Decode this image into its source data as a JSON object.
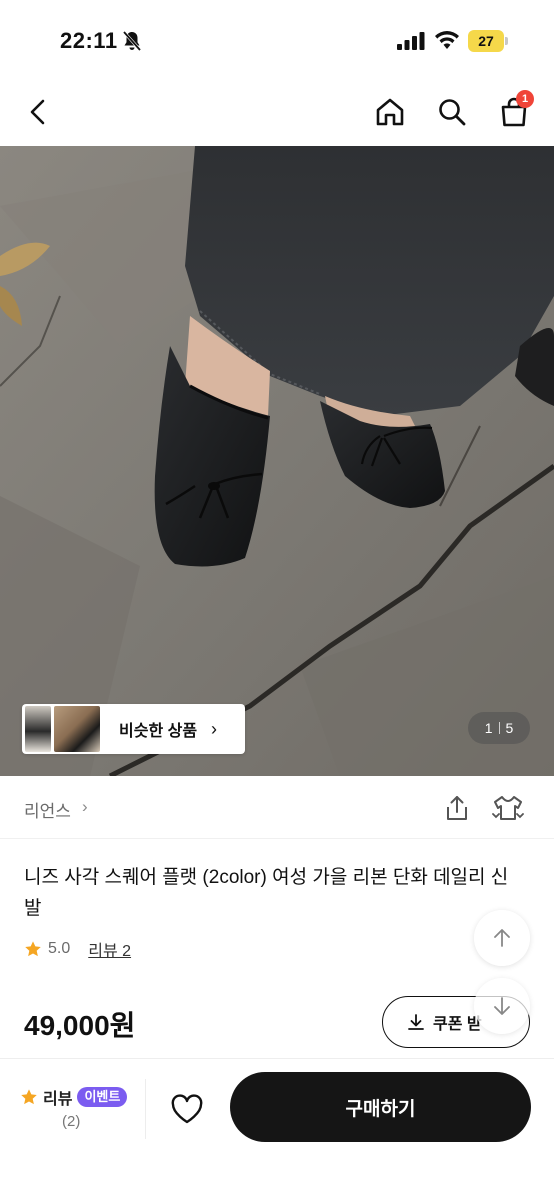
{
  "status_bar": {
    "time": "22:11",
    "battery": "27"
  },
  "nav": {
    "cart_count": "1"
  },
  "hero": {
    "similar_label": "비슷한 상품",
    "page_current": "1",
    "page_total": "5"
  },
  "product": {
    "brand": "리언스",
    "title": "니즈 사각 스퀘어 플랫 (2color) 여성 가을 리본 단화 데일리 신발",
    "rating": "5.0",
    "review_link": "리뷰 2",
    "price": "49,000원",
    "coupon_label": "쿠폰 받"
  },
  "bottom_bar": {
    "review_label": "리뷰",
    "event_label": "이벤트",
    "review_count": "(2)",
    "buy_label": "구매하기"
  },
  "colors": {
    "accent_red": "#f04438",
    "event_purple": "#7b5cf0",
    "star": "#f5a623",
    "buy_button": "#151515"
  }
}
